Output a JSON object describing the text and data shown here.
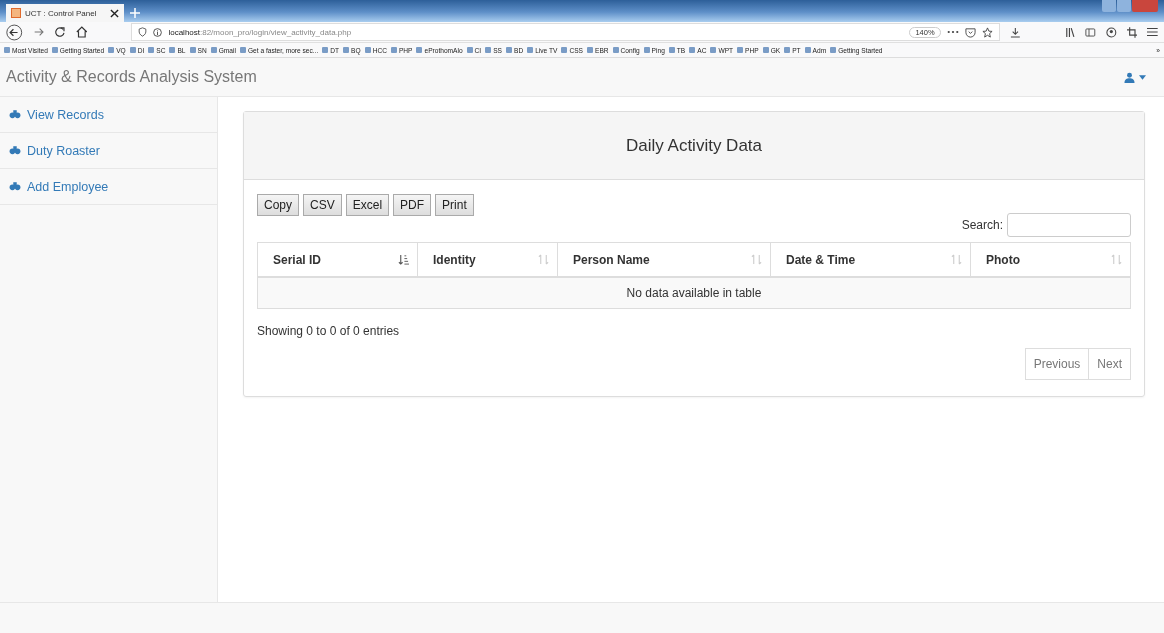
{
  "browser": {
    "tab_title": "UCT : Control Panel",
    "url_host": "localhost",
    "url_path": ":82/moon_pro/login/view_activity_data.php",
    "zoom": "140%",
    "bookmarks": [
      "Most Visited",
      "Getting Started",
      "VQ",
      "DI",
      "SC",
      "BL",
      "SN",
      "Gmail",
      "Get a faster, more sec...",
      "DT",
      "BQ",
      "HCC",
      "PHP",
      "eProthomAlo",
      "CI",
      "SS",
      "BD",
      "Live TV",
      "CSS",
      "EBR",
      "Config",
      "Ping",
      "TB",
      "AC",
      "WPT",
      "PHP",
      "GK",
      "PT",
      "Adm",
      "Getting Started"
    ],
    "more": "»"
  },
  "app": {
    "title": "Activity & Records Analysis System"
  },
  "sidebar": {
    "items": [
      "View Records",
      "Duty Roaster",
      "Add Employee"
    ]
  },
  "panel": {
    "title": "Daily Activity Data",
    "export_buttons": [
      "Copy",
      "CSV",
      "Excel",
      "PDF",
      "Print"
    ],
    "search": {
      "label": "Search:"
    },
    "table": {
      "columns": [
        {
          "label": "Serial ID",
          "sorted": true
        },
        {
          "label": "Identity",
          "sorted": false
        },
        {
          "label": "Person Name",
          "sorted": false
        },
        {
          "label": "Date & Time",
          "sorted": false
        },
        {
          "label": "Photo",
          "sorted": false
        }
      ],
      "empty_message": "No data available in table"
    },
    "info": "Showing 0 to 0 of 0 entries",
    "pagination": [
      {
        "label": "Previous",
        "disabled": true
      },
      {
        "label": "Next",
        "disabled": true
      }
    ]
  }
}
